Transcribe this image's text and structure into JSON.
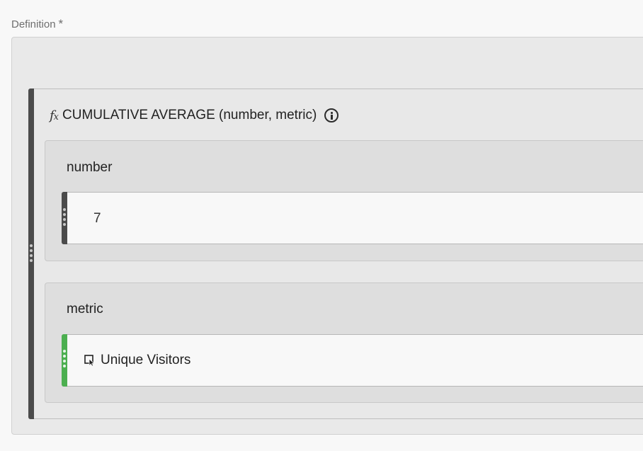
{
  "definition": {
    "label": "Definition",
    "required_mark": "*"
  },
  "function": {
    "icon": "function-fx-icon",
    "fx_glyph": "f",
    "fx_sub": "x",
    "signature": "CUMULATIVE AVERAGE (number, metric)",
    "info_icon": "info-icon",
    "bar_color": "#4b4b4b"
  },
  "params": [
    {
      "label": "number",
      "value": "7",
      "bar_color": "#4b4b4b"
    },
    {
      "label": "metric",
      "value": "Unique Visitors",
      "icon": "metric-icon",
      "bar_color": "#4caf50"
    }
  ]
}
